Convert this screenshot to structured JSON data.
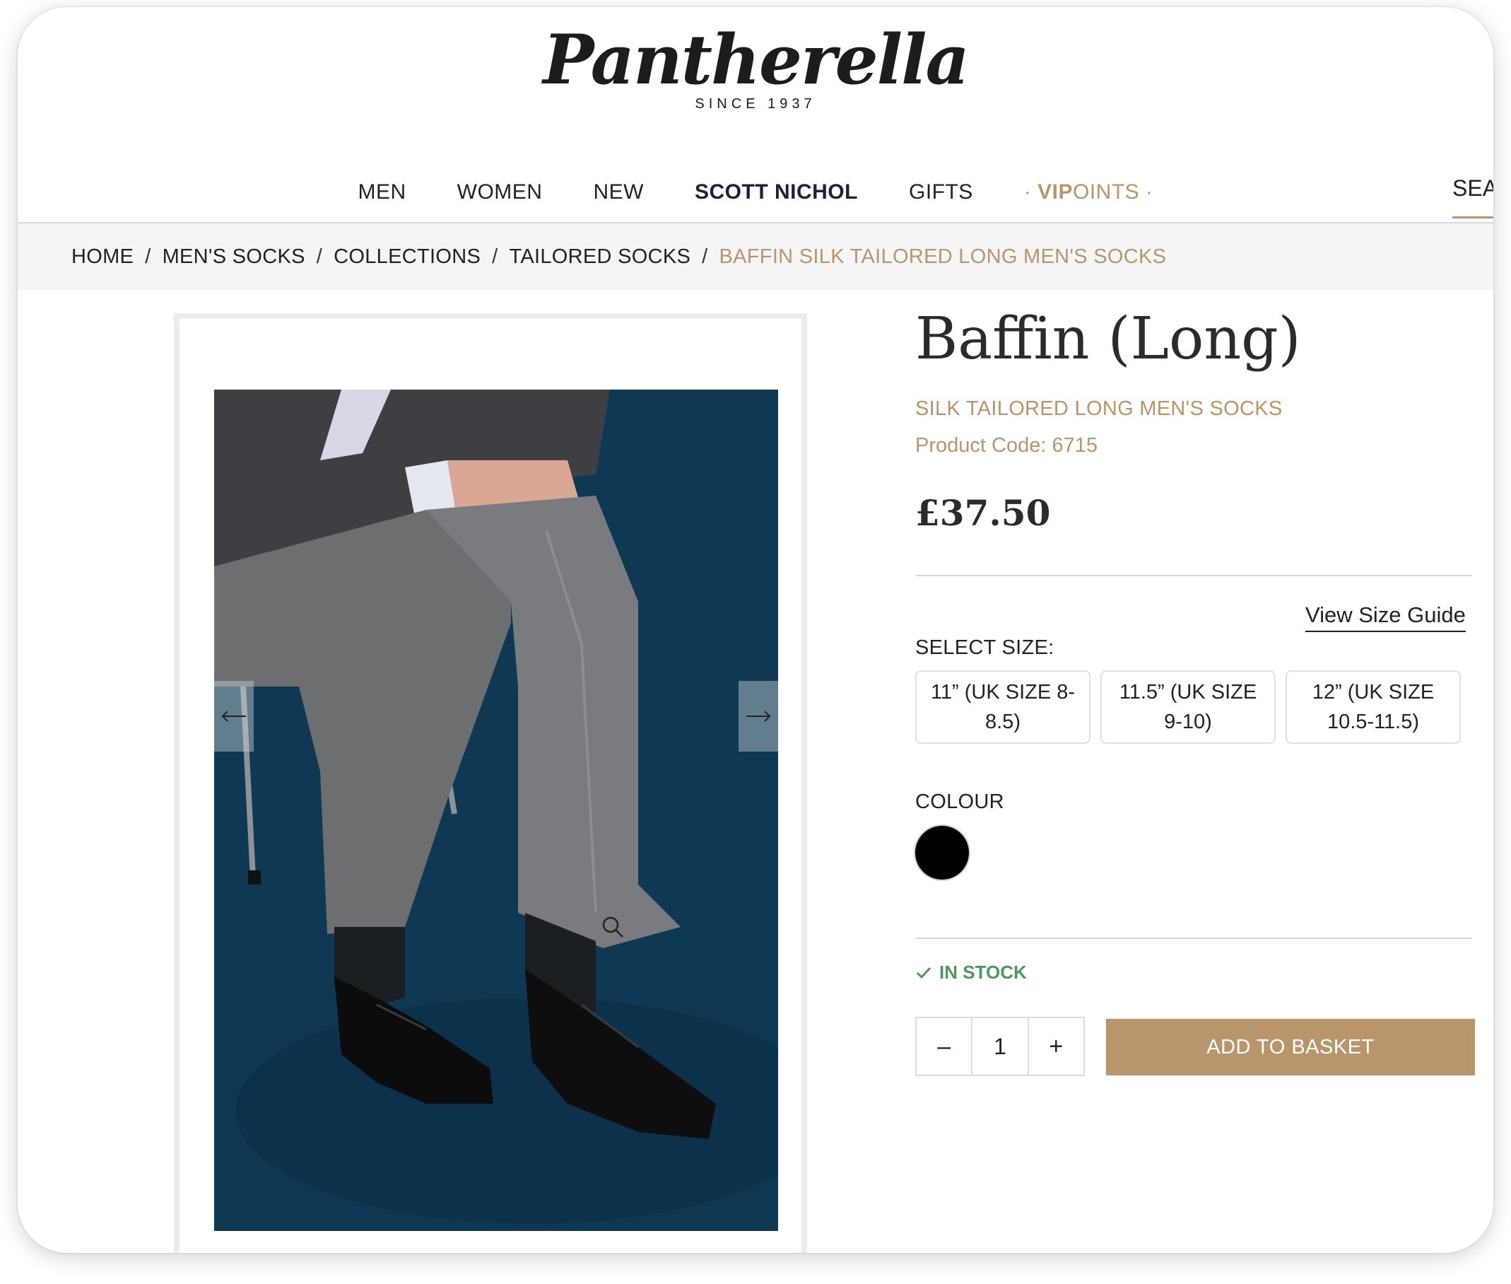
{
  "brand": {
    "logo_text": "Pantherella",
    "tagline": "SINCE 1937"
  },
  "nav": {
    "items": [
      "MEN",
      "WOMEN",
      "NEW",
      "SCOTT NICHOL",
      "GIFTS"
    ],
    "vip": {
      "prefix": "· ",
      "bold": "VIP",
      "rest": "OINTS",
      "suffix": " ·"
    },
    "search_label": "SEARCH"
  },
  "breadcrumb": {
    "items": [
      "HOME",
      "MEN'S SOCKS",
      "COLLECTIONS",
      "TAILORED SOCKS"
    ],
    "separator": "/",
    "current": "BAFFIN SILK TAILORED LONG MEN'S SOCKS"
  },
  "gallery": {
    "prev_icon": "arrow-left-icon",
    "next_icon": "arrow-right-icon",
    "zoom_icon": "zoom-icon"
  },
  "product": {
    "title": "Baffin (Long)",
    "subtitle": "SILK TAILORED LONG MEN'S SOCKS",
    "code": "Product Code: 6715",
    "price": "£37.50",
    "size_guide": "View Size Guide",
    "select_size_label": "SELECT SIZE:",
    "sizes": [
      "11” (UK SIZE 8-8.5)",
      "11.5” (UK SIZE 9-10)",
      "12” (UK SIZE 10.5-11.5)"
    ],
    "colour_label": "COLOUR",
    "colour_swatch": "#000000",
    "stock": "IN STOCK",
    "quantity": "1",
    "qty_minus": "–",
    "qty_plus": "+",
    "add_to_basket": "ADD TO BASKET"
  },
  "colors": {
    "accent": "#b8956a",
    "stock_green": "#4f9661",
    "nav_strong": "#1d1f3c"
  }
}
